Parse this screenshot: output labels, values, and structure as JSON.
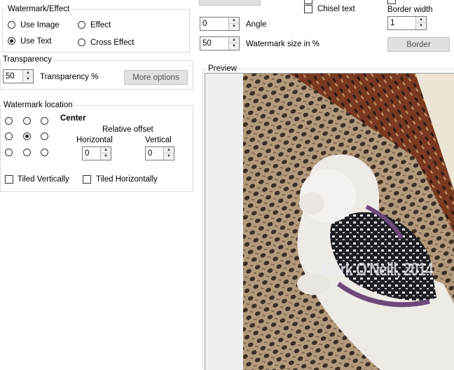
{
  "watermark_effect": {
    "title": "Watermark/Effect",
    "use_image": "Use Image",
    "use_text": "Use Text",
    "effect": "Effect",
    "cross_effect": "Cross Effect",
    "selected": "Use Text"
  },
  "transparency": {
    "title": "Transparency",
    "value": "50",
    "label": "Transparency %",
    "more_options": "More options"
  },
  "location": {
    "title": "Watermark location",
    "position_label": "Center",
    "relative_offset": "Relative offset",
    "horizontal_label": "Horizontal",
    "vertical_label": "Vertical",
    "horizontal_value": "0",
    "vertical_value": "0",
    "tiled_vertically": "Tiled Vertically",
    "tiled_horizontally": "Tiled Horizontally",
    "selected_cell": "center"
  },
  "text_settings": {
    "chisel_text": "Chisel text",
    "angle_value": "0",
    "angle_label": "Angle",
    "size_value": "50",
    "size_label": "Watermark size in %",
    "border_width_label": "Border width",
    "border_width_value": "1",
    "border_button": "Border"
  },
  "preview": {
    "title": "Preview",
    "watermark_text": "Mark O'Neill, 2014"
  },
  "colors": {
    "group_border": "#d5dfe5",
    "button_bg": "#e1e1e1",
    "carpet_bg": "#a08a70",
    "rug_red": "#7a3a22"
  }
}
